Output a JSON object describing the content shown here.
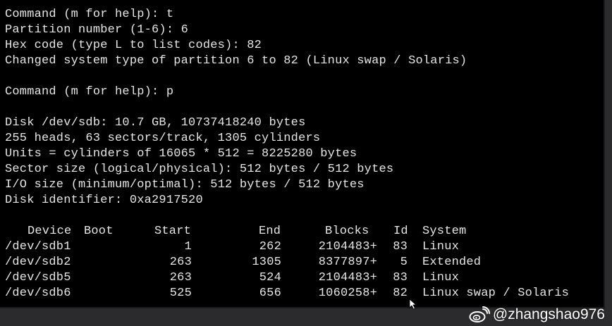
{
  "terminal": {
    "lines": [
      "Command (m for help): t",
      "Partition number (1-6): 6",
      "Hex code (type L to list codes): 82",
      "Changed system type of partition 6 to 82 (Linux swap / Solaris)",
      "",
      "Command (m for help): p",
      "",
      "Disk /dev/sdb: 10.7 GB, 10737418240 bytes",
      "255 heads, 63 sectors/track, 1305 cylinders",
      "Units = cylinders of 16065 * 512 = 8225280 bytes",
      "Sector size (logical/physical): 512 bytes / 512 bytes",
      "I/O size (minimum/optimal): 512 bytes / 512 bytes",
      "Disk identifier: 0xa2917520",
      ""
    ],
    "table": {
      "headers": {
        "device": "Device",
        "boot": "Boot",
        "start": "Start",
        "end": "End",
        "blocks": "Blocks",
        "id": "Id",
        "system": "System"
      },
      "rows": [
        {
          "device": "/dev/sdb1",
          "start": "1",
          "end": "262",
          "blocks": "2104483+",
          "id": "83",
          "system": "Linux"
        },
        {
          "device": "/dev/sdb2",
          "start": "263",
          "end": "1305",
          "blocks": "8377897+",
          "id": "5",
          "system": "Extended"
        },
        {
          "device": "/dev/sdb5",
          "start": "263",
          "end": "524",
          "blocks": "2104483+",
          "id": "83",
          "system": "Linux"
        },
        {
          "device": "/dev/sdb6",
          "start": "525",
          "end": "656",
          "blocks": "1060258+",
          "id": "82",
          "system": "Linux swap / Solaris"
        }
      ]
    }
  },
  "watermark": {
    "text": "@zhangshao976",
    "icon": "weibo-logo"
  },
  "colors": {
    "terminal_bg": "#000000",
    "terminal_fg": "#e6e6e6",
    "frame_bg": "#2b2b2d"
  }
}
